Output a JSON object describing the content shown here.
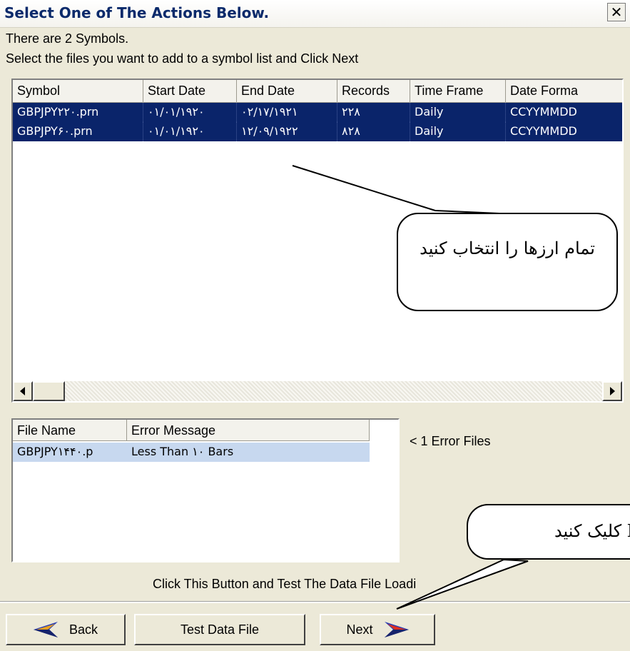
{
  "window": {
    "title": "Select One of The Actions Below.",
    "close_glyph": "✕"
  },
  "instructions": {
    "line1": "There are 2 Symbols.",
    "line2": "Select the files you want to add to a symbol list and Click Next"
  },
  "symbols_table": {
    "columns": [
      "Symbol",
      "Start Date",
      "End Date",
      "Records",
      "Time Frame",
      "Date Forma"
    ],
    "rows": [
      [
        "GBPJPY۲۲۰.prn",
        "۰۱/۰۱/۱۹۲۰",
        "۰۲/۱۷/۱۹۲۱",
        "۲۲۸",
        "Daily",
        "CCYYMMDD"
      ],
      [
        "GBPJPY۶۰.prn",
        "۰۱/۰۱/۱۹۲۰",
        "۱۲/۰۹/۱۹۲۲",
        "۸۲۸",
        "Daily",
        "CCYYMMDD"
      ]
    ]
  },
  "error_table": {
    "columns": [
      "File Name",
      "Error Message"
    ],
    "rows": [
      [
        "GBPJPY۱۴۴۰.p",
        "Less Than ۱۰ Bars"
      ]
    ],
    "count_label": "< 1 Error Files"
  },
  "hint": "Click This Button and Test The Data File Loadi",
  "buttons": {
    "back": "Back",
    "test": "Test Data File",
    "next": "Next"
  },
  "callouts": {
    "select_all": "تمام ارزها را انتخاب کنید",
    "click_next": "Ne کلیک کنید"
  },
  "colors": {
    "selection": "#0a246a",
    "error_row": "#c7d8ef",
    "back_arrow": "#2a3fb5",
    "next_arrow": "#2a3fb5"
  },
  "icons": {
    "back": "left-arrow-icon",
    "next": "right-arrow-icon",
    "scroll_left": "scroll-left-arrow-icon",
    "scroll_right": "scroll-right-arrow-icon"
  }
}
